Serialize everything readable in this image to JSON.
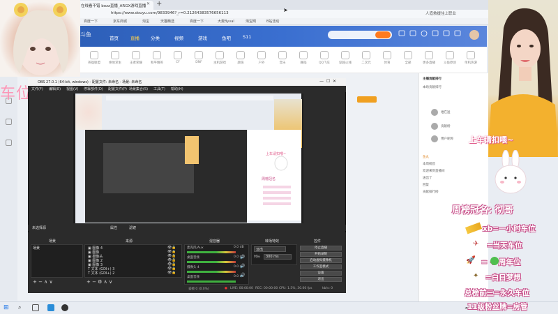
{
  "browser": {
    "tab_title": "在线看不错 bozz直播_ARGX游戏直播",
    "tab_close": "✕",
    "new_tab": "+",
    "url": "https://www.douyu.com/9833946?_r=0.21264383576656113",
    "url_right": "人造救援住上职业",
    "site_label": "斗鱼",
    "bookmarks": [
      "百度一下",
      "京东商城",
      "淘宝",
      "天猫精选",
      "百度一下",
      "大麦Byval",
      "淘宝网",
      "B站活动"
    ]
  },
  "douyu": {
    "logo": "斗鱼",
    "nav": [
      "首页",
      "直播",
      "分类",
      "视频",
      "游戏",
      "鱼吧",
      "S11"
    ],
    "categories": [
      "英雄联盟",
      "绝地求生",
      "王者荣耀",
      "和平精英",
      "CF",
      "DNF",
      "主机游戏",
      "颜值",
      "户外",
      "音乐",
      "舞蹈",
      "QQ飞车",
      "穿越火线",
      "二次元",
      "体育",
      "全部",
      "更多直播",
      "斗鱼原创",
      "单机热游",
      "网游竞技"
    ],
    "chat_header": "主播贡献排行",
    "chat_lines": [
      "本场贡献排行",
      "谁在送",
      "贡献榜",
      "用户昵称",
      "鱼丸",
      "本周榜首",
      "欢迎来到直播间",
      "送出了",
      "回复",
      "贡献排行榜"
    ]
  },
  "overlay_left": {
    "car_text": "车位: 2"
  },
  "obs": {
    "title": "OBS 27.0.1 (64-bit, windows) - 配置文件: 未命名 - 场景: 未命名",
    "menu": [
      "文件(F)",
      "编辑(E)",
      "视图(V)",
      "停靠部件(D)",
      "配置文件(P)",
      "场景集合(S)",
      "工具(T)",
      "帮助(H)"
    ],
    "no_source": "未选择源",
    "properties": "属性",
    "filters": "滤镜",
    "docks": {
      "scenes": "场景",
      "sources": "来源",
      "mixer": "混音器",
      "transitions": "转场特效",
      "controls": "控件"
    },
    "scene_list": [
      "场景"
    ],
    "sources": [
      "图像 4",
      "图像",
      "摄像头",
      "图像 2",
      "图像 3",
      "文本 (GDI+) 3",
      "文本 (GDI+) 2"
    ],
    "mixer": [
      {
        "name": "麦克风/Aux",
        "level": "0.0 dB"
      },
      {
        "name": "桌面音频",
        "level": "0.0 dB"
      },
      {
        "name": "摄像头 4",
        "level": "0.0 dB"
      },
      {
        "name": "桌面音频",
        "level": "0.0 dB"
      }
    ],
    "transition": "淡出",
    "duration_label": "时长",
    "duration": "300 ms",
    "controls": [
      "停止直播",
      "开始录制",
      "启动虚拟摄像机",
      "工作室模式",
      "设置",
      "退出"
    ],
    "status": {
      "dropped": "丢帧 0 (0.0%)",
      "live": "LIVE: 00:00:00",
      "rec": "REC: 00:00:00",
      "cpu": "CPU: 1.5%, 30.00 fps",
      "kbps": "kb/s: 0"
    }
  },
  "overlay_right": {
    "shangche": "上车请扣喂~",
    "zhoubang": "周榜冠名: 彻哥",
    "rules": [
      "xb=一小时车位",
      "=当天车位",
      "=  + 周年位",
      "=白日梦想",
      "总榜前三=永久车位",
      "11级粉丝牌=房管"
    ]
  },
  "taskbar": {
    "search": "",
    "time": "14",
    "sys": "中"
  }
}
